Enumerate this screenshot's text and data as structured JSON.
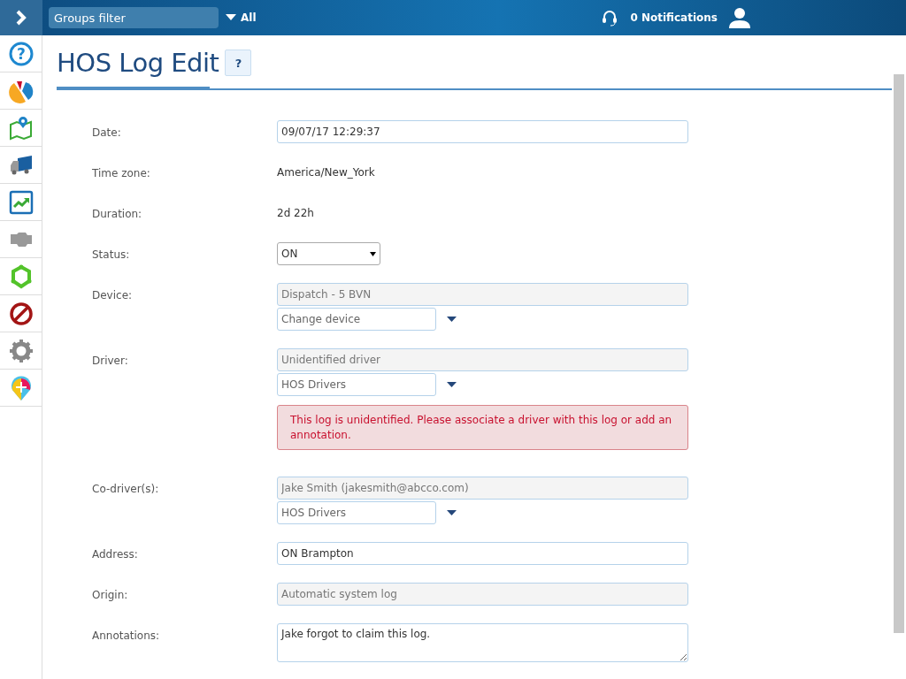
{
  "topbar": {
    "groups_filter": {
      "placeholder": "Groups filter"
    },
    "groups_dropdown": "All",
    "notifications": "0 Notifications"
  },
  "sidebar": {
    "help_icon": "?"
  },
  "page": {
    "title": "HOS Log Edit",
    "help_button": "?"
  },
  "fields": [
    {
      "label": "Date:",
      "controls": [
        {
          "kind": "input",
          "value": "09/07/17 12:29:37"
        }
      ]
    },
    {
      "label": "Time zone:",
      "controls": [
        {
          "kind": "text",
          "value": "America/New_York"
        }
      ]
    },
    {
      "label": "Duration:",
      "controls": [
        {
          "kind": "text",
          "value": "2d 22h"
        }
      ]
    },
    {
      "label": "Status:",
      "controls": [
        {
          "kind": "select",
          "value": "ON"
        }
      ]
    },
    {
      "label": "Device:",
      "controls": [
        {
          "kind": "readonly",
          "value": "Dispatch - 5 BVN"
        },
        {
          "kind": "combo",
          "placeholder": "Change device"
        }
      ]
    },
    {
      "label": "Driver:",
      "controls": [
        {
          "kind": "readonly",
          "value": "Unidentified driver"
        },
        {
          "kind": "combo",
          "placeholder": "HOS Drivers"
        },
        {
          "kind": "alert",
          "value": "This log is unidentified. Please associate a driver with this log or add an annotation."
        }
      ]
    },
    {
      "label": "Co-driver(s):",
      "controls": [
        {
          "kind": "readonly",
          "value": "Jake Smith (jakesmith@abcco.com)"
        },
        {
          "kind": "combo",
          "placeholder": "HOS Drivers"
        }
      ]
    },
    {
      "label": "Address:",
      "controls": [
        {
          "kind": "input",
          "value": "ON Brampton"
        }
      ]
    },
    {
      "label": "Origin:",
      "controls": [
        {
          "kind": "readonly",
          "value": "Automatic system log"
        }
      ]
    },
    {
      "label": "Annotations:",
      "controls": [
        {
          "kind": "textarea",
          "value": "Jake forgot to claim this log."
        }
      ]
    }
  ]
}
